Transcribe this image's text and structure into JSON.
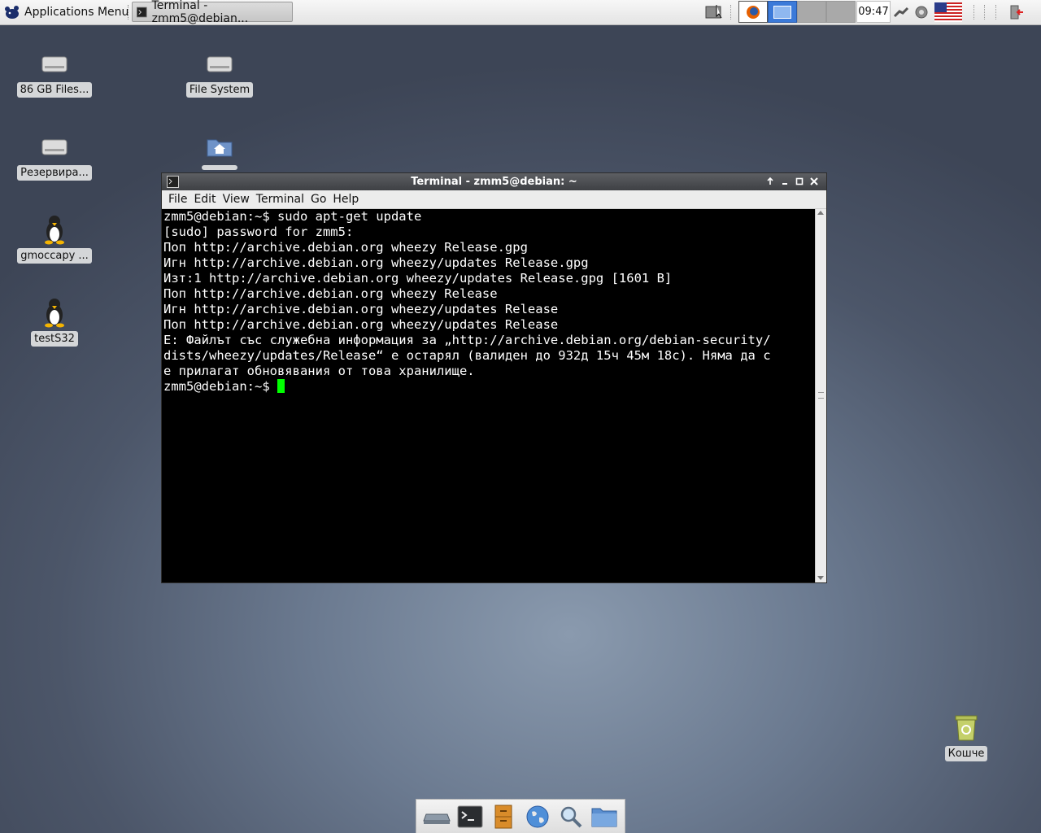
{
  "panel": {
    "app_menu_label": "Applications Menu",
    "task_label": "Terminal - zmm5@debian...",
    "clock": "09:47"
  },
  "desktop_icons": [
    {
      "label": "86 GB Files...",
      "icon": "drive-icon"
    },
    {
      "label": "File System",
      "icon": "drive-icon"
    },
    {
      "label": "Резервира...",
      "icon": "drive-icon"
    },
    {
      "label": "",
      "icon": "home-folder-icon"
    },
    {
      "label": "gmoccapy ...",
      "icon": "penguin-icon"
    },
    {
      "label": "testS32",
      "icon": "penguin-icon"
    },
    {
      "label": "Кошче",
      "icon": "trash-icon"
    }
  ],
  "terminal": {
    "title": "Terminal - zmm5@debian: ~",
    "menu": [
      "File",
      "Edit",
      "View",
      "Terminal",
      "Go",
      "Help"
    ],
    "lines": [
      "zmm5@debian:~$ sudo apt-get update",
      "[sudo] password for zmm5:",
      "Поп http://archive.debian.org wheezy Release.gpg",
      "Игн http://archive.debian.org wheezy/updates Release.gpg",
      "Изт:1 http://archive.debian.org wheezy/updates Release.gpg [1601 B]",
      "Поп http://archive.debian.org wheezy Release",
      "Игн http://archive.debian.org wheezy/updates Release",
      "Поп http://archive.debian.org wheezy/updates Release",
      "E: Файлът със служебна информация за „http://archive.debian.org/debian-security/",
      "dists/wheezy/updates/Release“ е остарял (валиден до 932д 15ч 45м 18с). Няма да с",
      "е прилагат обновявания от това хранилище."
    ],
    "prompt": "zmm5@debian:~$ "
  },
  "dock": [
    "drive-icon",
    "terminal-icon",
    "file-cabinet-icon",
    "globe-icon",
    "search-icon",
    "folder-icon"
  ],
  "colors": {
    "cursor": "#00ff00",
    "terminal_bg": "#000000",
    "titlebar": "#4a4c50"
  }
}
